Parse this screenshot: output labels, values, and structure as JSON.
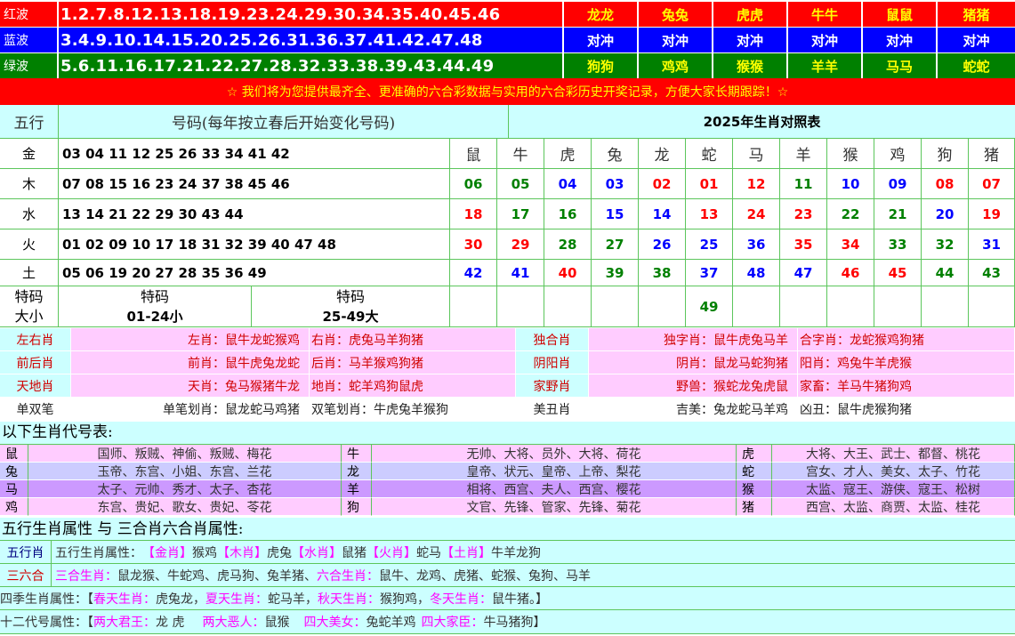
{
  "waves": [
    {
      "name": "红波",
      "numbers": "1.2.7.8.12.13.18.19.23.24.29.30.34.35.40.45.46",
      "zodiacs": [
        "龙龙",
        "兔兔",
        "虎虎",
        "牛牛",
        "鼠鼠",
        "猪猪"
      ],
      "bg": "#ff0000",
      "zod_bg": "#ff0000",
      "zod_color": "#ffff00"
    },
    {
      "name": "蓝波",
      "numbers": "3.4.9.10.14.15.20.25.26.31.36.37.41.42.47.48",
      "zodiacs": [
        "对冲",
        "对冲",
        "对冲",
        "对冲",
        "对冲",
        "对冲"
      ],
      "bg": "#0000ff",
      "zod_bg": "#0000ff",
      "zod_color": "#ffffff"
    },
    {
      "name": "绿波",
      "numbers": "5.6.11.16.17.21.22.27.28.32.33.38.39.43.44.49",
      "zodiacs": [
        "狗狗",
        "鸡鸡",
        "猴猴",
        "羊羊",
        "马马",
        "蛇蛇"
      ],
      "bg": "#008000",
      "zod_bg": "#008000",
      "zod_color": "#ffff00"
    }
  ],
  "banner": "☆ 我们将为您提供最齐全、更准确的六合彩数据与实用的六合彩历史开奖记录，方便大家长期跟踪！☆",
  "header": {
    "wuxing": "五行",
    "haoma": "号码(每年按立春后开始变化号码)",
    "year_title": "2025年生肖对照表"
  },
  "elements": [
    {
      "name": "金",
      "numbers": "03 04 11 12 25 26 33 34 41 42"
    },
    {
      "name": "木",
      "numbers": "07 08 15 16 23 24 37 38 45 46"
    },
    {
      "name": "水",
      "numbers": "13 14 21 22 29 30 43 44"
    },
    {
      "name": "火",
      "numbers": "01 02 09 10 17 18 31 32 39 40 47 48"
    },
    {
      "name": "土",
      "numbers": "05 06 19 20 27 28 35 36 49"
    }
  ],
  "zodiac_names": [
    "鼠",
    "牛",
    "虎",
    "兔",
    "龙",
    "蛇",
    "马",
    "羊",
    "猴",
    "鸡",
    "狗",
    "猪"
  ],
  "zodiac_numbers": [
    [
      {
        "v": "06",
        "c": "green"
      },
      {
        "v": "05",
        "c": "green"
      },
      {
        "v": "04",
        "c": "blue"
      },
      {
        "v": "03",
        "c": "blue"
      },
      {
        "v": "02",
        "c": "red"
      },
      {
        "v": "01",
        "c": "red"
      },
      {
        "v": "12",
        "c": "red"
      },
      {
        "v": "11",
        "c": "green"
      },
      {
        "v": "10",
        "c": "blue"
      },
      {
        "v": "09",
        "c": "blue"
      },
      {
        "v": "08",
        "c": "red"
      },
      {
        "v": "07",
        "c": "red"
      }
    ],
    [
      {
        "v": "18",
        "c": "red"
      },
      {
        "v": "17",
        "c": "green"
      },
      {
        "v": "16",
        "c": "green"
      },
      {
        "v": "15",
        "c": "blue"
      },
      {
        "v": "14",
        "c": "blue"
      },
      {
        "v": "13",
        "c": "red"
      },
      {
        "v": "24",
        "c": "red"
      },
      {
        "v": "23",
        "c": "red"
      },
      {
        "v": "22",
        "c": "green"
      },
      {
        "v": "21",
        "c": "green"
      },
      {
        "v": "20",
        "c": "blue"
      },
      {
        "v": "19",
        "c": "red"
      }
    ],
    [
      {
        "v": "30",
        "c": "red"
      },
      {
        "v": "29",
        "c": "red"
      },
      {
        "v": "28",
        "c": "green"
      },
      {
        "v": "27",
        "c": "green"
      },
      {
        "v": "26",
        "c": "blue"
      },
      {
        "v": "25",
        "c": "blue"
      },
      {
        "v": "36",
        "c": "blue"
      },
      {
        "v": "35",
        "c": "red"
      },
      {
        "v": "34",
        "c": "red"
      },
      {
        "v": "33",
        "c": "green"
      },
      {
        "v": "32",
        "c": "green"
      },
      {
        "v": "31",
        "c": "blue"
      }
    ],
    [
      {
        "v": "42",
        "c": "blue"
      },
      {
        "v": "41",
        "c": "blue"
      },
      {
        "v": "40",
        "c": "red"
      },
      {
        "v": "39",
        "c": "green"
      },
      {
        "v": "38",
        "c": "green"
      },
      {
        "v": "37",
        "c": "blue"
      },
      {
        "v": "48",
        "c": "blue"
      },
      {
        "v": "47",
        "c": "blue"
      },
      {
        "v": "46",
        "c": "red"
      },
      {
        "v": "45",
        "c": "red"
      },
      {
        "v": "44",
        "c": "green"
      },
      {
        "v": "43",
        "c": "green"
      }
    ],
    [
      {
        "v": "",
        "c": "green"
      },
      {
        "v": "",
        "c": "green"
      },
      {
        "v": "",
        "c": "green"
      },
      {
        "v": "",
        "c": "green"
      },
      {
        "v": "",
        "c": "green"
      },
      {
        "v": "49",
        "c": "green"
      },
      {
        "v": "",
        "c": "green"
      },
      {
        "v": "",
        "c": "green"
      },
      {
        "v": "",
        "c": "green"
      },
      {
        "v": "",
        "c": "green"
      },
      {
        "v": "",
        "c": "green"
      },
      {
        "v": "",
        "c": "green"
      }
    ]
  ],
  "tema": {
    "label1": "特码",
    "label2": "大小",
    "small_title": "特码",
    "small_range": "01-24小",
    "big_title": "特码",
    "big_range": "25-49大"
  },
  "attr_rows": [
    {
      "a": "左右肖",
      "b": "左肖：鼠牛龙蛇猴鸡",
      "c": "右肖：虎兔马羊狗猪",
      "d": "独合肖",
      "e": "独字肖：鼠牛虎兔马羊",
      "f": "合字肖：龙蛇猴鸡狗猪",
      "style": "pink"
    },
    {
      "a": "前后肖",
      "b": "前肖：鼠牛虎兔龙蛇",
      "c": "后肖：马羊猴鸡狗猪",
      "d": "阴阳肖",
      "e": "阴肖：鼠龙马蛇狗猪",
      "f": "阳肖：鸡兔牛羊虎猴",
      "style": "pink"
    },
    {
      "a": "天地肖",
      "b": "天肖：兔马猴猪牛龙",
      "c": "地肖：蛇羊鸡狗鼠虎",
      "d": "家野肖",
      "e": "野兽：猴蛇龙兔虎鼠",
      "f": "家畜：羊马牛猪狗鸡",
      "style": "pink"
    },
    {
      "a": "单双笔",
      "b": "单笔划肖：鼠龙蛇马鸡猪",
      "c": "双笔划肖：牛虎兔羊猴狗",
      "d": "美丑肖",
      "e": "吉美：兔龙蛇马羊鸡",
      "f": "凶丑：鼠牛虎猴狗猪",
      "style": "plain"
    }
  ],
  "code_title": "以下生肖代号表:",
  "code_rows": [
    {
      "bg": "#ffccff",
      "items": [
        {
          "z": "鼠",
          "t": "国师、叛贼、神偷、叛贼、梅花"
        },
        {
          "z": "牛",
          "t": "无帅、大将、员外、大将、荷花"
        },
        {
          "z": "虎",
          "t": "大将、大王、武士、都督、桃花"
        }
      ]
    },
    {
      "bg": "#ccccff",
      "items": [
        {
          "z": "兔",
          "t": "玉帝、东宫、小姐、东宫、兰花"
        },
        {
          "z": "龙",
          "t": "皇帝、状元、皇帝、上帝、梨花"
        },
        {
          "z": "蛇",
          "t": "宫女、才人、美女、太子、竹花"
        }
      ]
    },
    {
      "bg": "#cc99ff",
      "items": [
        {
          "z": "马",
          "t": "太子、元帅、秀才、太子、杏花"
        },
        {
          "z": "羊",
          "t": "相将、西宫、夫人、西宫、樱花"
        },
        {
          "z": "猴",
          "t": "太监、寇王、游侠、寇王、松树"
        }
      ]
    },
    {
      "bg": "#ffccff",
      "items": [
        {
          "z": "鸡",
          "t": "东宫、贵妃、歌女、贵妃、苓花"
        },
        {
          "z": "狗",
          "t": "文官、先锋、管家、先锋、菊花"
        },
        {
          "z": "猪",
          "t": "西宫、太监、商贾、太监、桂花"
        }
      ]
    }
  ],
  "wuxing_title": "五行生肖属性 与 三合肖六合肖属性:",
  "wuxing_row": {
    "label": "五行肖",
    "prefix": "五行生肖属性：",
    "parts": [
      {
        "k": "【金肖】",
        "v": "猴鸡"
      },
      {
        "k": "【木肖】",
        "v": "虎兔"
      },
      {
        "k": "【水肖】",
        "v": "鼠猪"
      },
      {
        "k": "【火肖】",
        "v": "蛇马"
      },
      {
        "k": "【土肖】",
        "v": "牛羊龙狗"
      }
    ]
  },
  "sanhe_row": {
    "label": "三六合",
    "k1": "三合生肖：",
    "v1": "鼠龙猴、牛蛇鸡、虎马狗、兔羊猪、",
    "k2": "六合生肖：",
    "v2": "鼠牛、龙鸡、虎猪、蛇猴、兔狗、马羊"
  },
  "season_row": {
    "prefix": "四季生肖属性：【",
    "k1": "春天生肖：",
    "v1": "虎兔龙，",
    "k2": "夏天生肖：",
    "v2": "蛇马羊，",
    "k3": "秋天生肖：",
    "v3": "猴狗鸡，",
    "k4": "冬天生肖：",
    "v4": "鼠牛猪。】"
  },
  "twelve_row": {
    "prefix": "十二代号属性：【",
    "k1": "两大君王：",
    "v1": "龙 虎",
    "k2": "两大恶人：",
    "v2": "鼠猴",
    "k3": "四大美女：",
    "v3": "兔蛇羊鸡",
    "k4": "四大家臣：",
    "v4": "牛马猪狗】"
  }
}
